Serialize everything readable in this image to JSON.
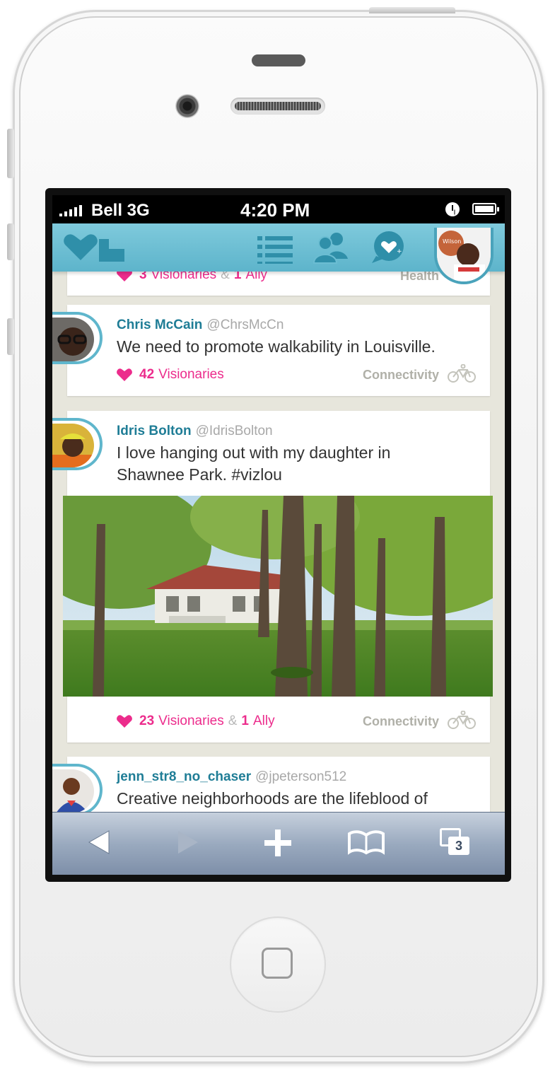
{
  "status": {
    "carrier": "Bell 3G",
    "time": "4:20 PM"
  },
  "nav": {
    "logo": "heart-pin-logo",
    "icons": [
      "list-icon",
      "people-icon",
      "speech-heart-icon"
    ],
    "profile": "profile-avatar"
  },
  "partial_post": {
    "visionaries": "3",
    "visionaries_label": "Visionaries",
    "amp": "&",
    "allies": "1",
    "allies_label": "Ally",
    "category": "Health"
  },
  "posts": [
    {
      "name": "Chris McCain",
      "handle": "@ChrsMcCn",
      "text": "We need to promote walkability in Louisville.",
      "visionaries": "42",
      "visionaries_label": "Visionaries",
      "category": "Connectivity",
      "category_icon": "bicycle-icon"
    },
    {
      "name": "Idris Bolton",
      "handle": "@IdrisBolton",
      "text": "I love hanging out with my daughter in Shawnee Park. #vizlou",
      "photo": "park-pavilion-photo",
      "visionaries": "23",
      "visionaries_label": "Visionaries",
      "amp": "&",
      "allies": "1",
      "allies_label": "Ally",
      "category": "Connectivity",
      "category_icon": "bicycle-icon"
    },
    {
      "name": "jenn_str8_no_chaser",
      "handle": "@jpeterson512",
      "text": "Creative neighborhoods are the lifeblood of"
    }
  ],
  "toolbar": {
    "tabs_count": "3",
    "icons": [
      "back-icon",
      "forward-icon",
      "add-icon",
      "bookmarks-icon",
      "tabs-icon"
    ]
  },
  "colors": {
    "accent": "#5db4cb",
    "name": "#1f7d96",
    "pink": "#ec2c8c"
  }
}
